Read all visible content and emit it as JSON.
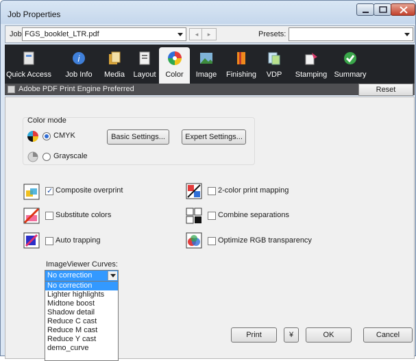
{
  "window": {
    "title": "Job Properties"
  },
  "jobbar": {
    "job_label": "Job:",
    "job_value": "FGS_booklet_LTR.pdf",
    "presets_label": "Presets:",
    "presets_value": "",
    "prev_glyph": "◂",
    "next_glyph": "▸"
  },
  "toolbar": {
    "tabs": [
      {
        "label": "Quick Access",
        "icon": "quick-access-icon"
      },
      {
        "label": "Job Info",
        "icon": "info-icon"
      },
      {
        "label": "Media",
        "icon": "media-icon"
      },
      {
        "label": "Layout",
        "icon": "layout-icon"
      },
      {
        "label": "Color",
        "icon": "color-wheel-icon",
        "active": true
      },
      {
        "label": "Image",
        "icon": "image-icon"
      },
      {
        "label": "Finishing",
        "icon": "finishing-icon"
      },
      {
        "label": "VDP",
        "icon": "vdp-icon"
      },
      {
        "label": "Stamping",
        "icon": "stamping-icon"
      },
      {
        "label": "Summary",
        "icon": "summary-check-icon"
      }
    ]
  },
  "strip": {
    "label": "Adobe PDF Print Engine Preferred",
    "reset": "Reset"
  },
  "color_mode": {
    "title": "Color mode",
    "cmyk": "CMYK",
    "grayscale": "Grayscale",
    "selected": "CMYK",
    "basic": "Basic Settings...",
    "expert": "Expert Settings..."
  },
  "options": {
    "composite_overprint": {
      "label": "Composite overprint",
      "checked": true
    },
    "two_color": {
      "label": "2-color print mapping",
      "checked": false
    },
    "substitute": {
      "label": "Substitute colors",
      "checked": false
    },
    "combine": {
      "label": "Combine separations",
      "checked": false
    },
    "auto_trapping": {
      "label": "Auto trapping",
      "checked": false
    },
    "optimize_rgb": {
      "label": "Optimize RGB transparency",
      "checked": false
    }
  },
  "curves": {
    "label": "ImageViewer Curves:",
    "value": "No correction",
    "options": [
      "No correction",
      "Lighter highlights",
      "Midtone boost",
      "Shadow detail",
      "Reduce C cast",
      "Reduce M cast",
      "Reduce Y cast",
      "demo_curve"
    ]
  },
  "footer": {
    "print": "Print",
    "more": "¥",
    "ok": "OK",
    "cancel": "Cancel"
  },
  "colors": {
    "accent": "#3399ff",
    "toolbar_bg": "#222428",
    "panel_bg": "#f0f0f0"
  }
}
